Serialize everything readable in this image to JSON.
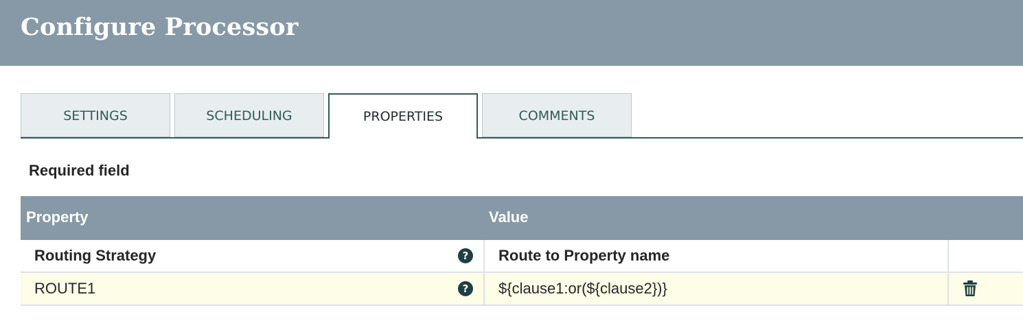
{
  "header": {
    "title": "Configure Processor"
  },
  "tabs": [
    {
      "label": "SETTINGS",
      "active": false
    },
    {
      "label": "SCHEDULING",
      "active": false
    },
    {
      "label": "PROPERTIES",
      "active": true
    },
    {
      "label": "COMMENTS",
      "active": false
    }
  ],
  "required_label": "Required field",
  "grid": {
    "columns": {
      "property": "Property",
      "value": "Value"
    },
    "rows": [
      {
        "name": "Routing Strategy",
        "value": "Route to Property name",
        "help_icon": "question-circle-icon",
        "deletable": false
      },
      {
        "name": "ROUTE1",
        "value": "${clause1:or(${clause2})}",
        "help_icon": "question-circle-icon",
        "deletable": true,
        "delete_icon": "trash-icon"
      }
    ]
  },
  "colors": {
    "header_bg": "#8799a6",
    "accent": "#2f5b5b",
    "row_highlight": "#fdfde8",
    "icon": "#1f3f44"
  }
}
